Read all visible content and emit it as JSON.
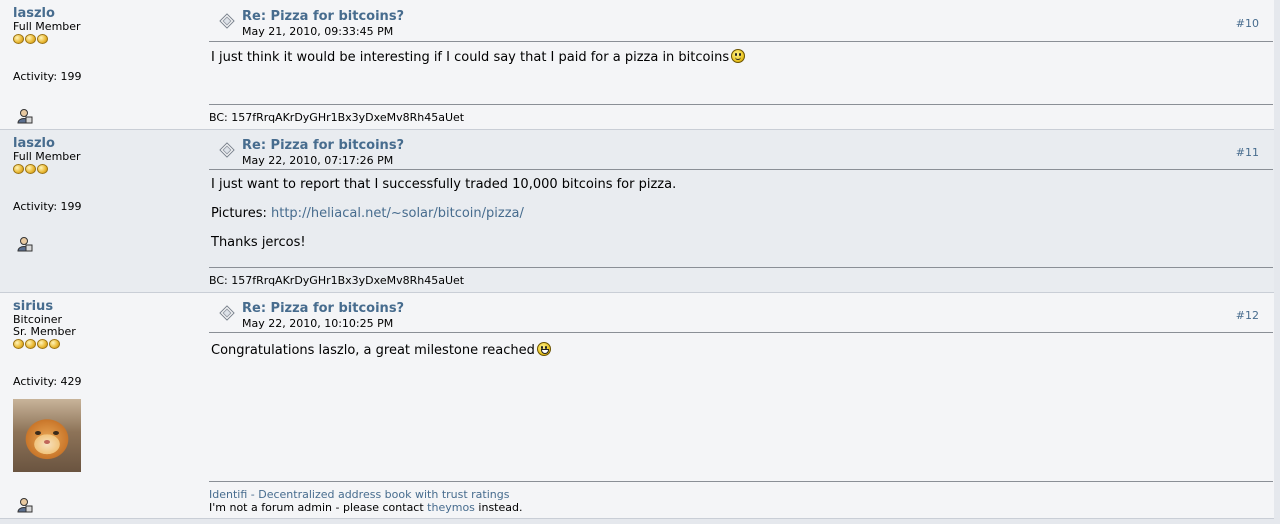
{
  "posts": [
    {
      "username": "laszlo",
      "rank": "Full Member",
      "rank2": "",
      "stars": 3,
      "activity": "Activity: 199",
      "title": "Re: Pizza for bitcoins?",
      "date": "May 21, 2010, 09:33:45 PM",
      "number": "#10",
      "text": "I just think it would be interesting if I could say that I paid for a pizza in bitcoins",
      "signature": "BC: 157fRrqAKrDyGHr1Bx3yDxeMv8Rh45aUet"
    },
    {
      "username": "laszlo",
      "rank": "Full Member",
      "stars": 3,
      "activity": "Activity: 199",
      "title": "Re: Pizza for bitcoins?",
      "date": "May 22, 2010, 07:17:26 PM",
      "number": "#11",
      "text1": "I just want to report that I successfully traded 10,000 bitcoins for pizza.",
      "pictures_label": "Pictures:",
      "pictures_link": "http://heliacal.net/~solar/bitcoin/pizza/",
      "text3": "Thanks jercos!",
      "signature": "BC: 157fRrqAKrDyGHr1Bx3yDxeMv8Rh45aUet"
    },
    {
      "username": "sirius",
      "rank": "Bitcoiner",
      "rank2": "Sr. Member",
      "stars": 4,
      "activity": "Activity: 429",
      "title": "Re: Pizza for bitcoins?",
      "date": "May 22, 2010, 10:10:25 PM",
      "number": "#12",
      "text": "Congratulations laszlo, a great milestone reached",
      "sig_link": "Identifi - Decentralized address book with trust ratings",
      "sig_line2_a": "I'm not a forum admin - please contact",
      "sig_line2_link": "theymos",
      "sig_line2_b": "instead."
    }
  ],
  "icons": {
    "post": "document-icon",
    "profile": "profile-icon",
    "smiley": "smiley-icon",
    "grin": "grin-icon"
  },
  "colors": {
    "link": "#476c8e",
    "bg_light": "#f4f5f7",
    "bg_dark": "#e9ecf0"
  }
}
